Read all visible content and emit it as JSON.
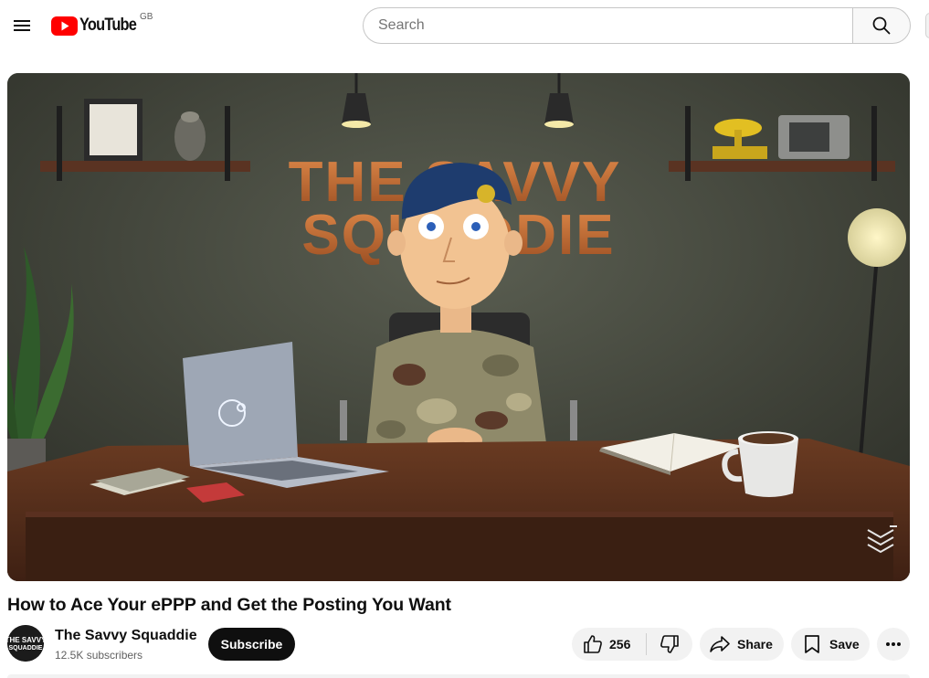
{
  "masthead": {
    "logo_text": "YouTube",
    "country_code": "GB",
    "search_placeholder": "Search"
  },
  "player": {
    "scene_title_line1": "THE SAVVY",
    "scene_title_line2": "SQUADDIE"
  },
  "video": {
    "title": "How to Ace Your ePPP and Get the Posting You Want"
  },
  "channel": {
    "name": "The Savvy Squaddie",
    "subscribers": "12.5K subscribers",
    "avatar_text_line1": "THE SAVVY",
    "avatar_text_line2": "SQUADDIE"
  },
  "actions": {
    "subscribe_label": "Subscribe",
    "like_count": "256",
    "share_label": "Share",
    "save_label": "Save"
  },
  "colors": {
    "brand_red": "#ff0000",
    "subscribe_bg": "#0f0f0f",
    "pill_bg": "#f2f2f2"
  },
  "icons": [
    "menu-icon",
    "youtube-logo-icon",
    "search-icon",
    "like-icon",
    "dislike-icon",
    "share-icon",
    "save-icon",
    "more-icon"
  ]
}
